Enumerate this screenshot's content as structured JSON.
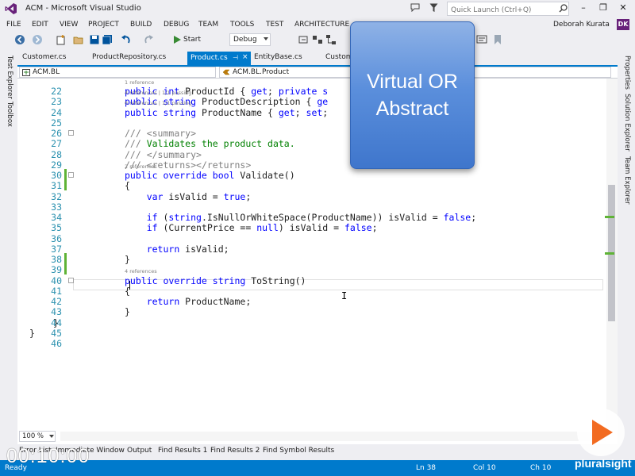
{
  "window": {
    "title": "ACM - Microsoft Visual Studio",
    "quick_launch_placeholder": "Quick Launch (Ctrl+Q)",
    "user_name": "Deborah Kurata",
    "user_initials": "DK",
    "minimize_glyph": "–",
    "restore_glyph": "❐",
    "close_glyph": "✕"
  },
  "menu": [
    "FILE",
    "EDIT",
    "VIEW",
    "PROJECT",
    "BUILD",
    "DEBUG",
    "TEAM",
    "TOOLS",
    "TEST",
    "ARCHITECTURE"
  ],
  "toolbar": {
    "start_label": "Start",
    "configuration": "Debug"
  },
  "side_tabs": {
    "left": [
      "Test Explorer",
      "Toolbox"
    ],
    "right": [
      "Properties",
      "Solution Explorer",
      "Team Explorer"
    ]
  },
  "doc_tabs": {
    "items": [
      "Customer.cs",
      "ProductRepository.cs",
      "Product.cs",
      "EntityBase.cs",
      "Custom"
    ],
    "active": "Product.cs",
    "pin_glyph": "⊣",
    "close_glyph": "×"
  },
  "navbar": {
    "project": "ACM.BL",
    "class": "ACM.BL.Product"
  },
  "code": {
    "lines": [
      {
        "n": "22",
        "refs": "1 reference",
        "segments": [
          {
            "t": "public ",
            "k": "kw"
          },
          {
            "t": "int ",
            "k": "kw"
          },
          {
            "t": "ProductId { ",
            "k": ""
          },
          {
            "t": "get",
            "k": "kw"
          },
          {
            "t": "; ",
            "k": ""
          },
          {
            "t": "private ",
            "k": "kw"
          },
          {
            "t": "s",
            "k": "kw"
          }
        ]
      },
      {
        "n": "23",
        "refs": "4 references | 1/1 passing",
        "segments": [
          {
            "t": "public ",
            "k": "kw"
          },
          {
            "t": "string ",
            "k": "kw"
          },
          {
            "t": "ProductDescription { ",
            "k": ""
          },
          {
            "t": "ge",
            "k": "kw"
          }
        ]
      },
      {
        "n": "24",
        "refs": "6 references | 1/1 passing",
        "segments": [
          {
            "t": "public ",
            "k": "kw"
          },
          {
            "t": "string ",
            "k": "kw"
          },
          {
            "t": "ProductName { ",
            "k": ""
          },
          {
            "t": "get",
            "k": "kw"
          },
          {
            "t": "; ",
            "k": ""
          },
          {
            "t": "set",
            "k": "kw"
          },
          {
            "t": ";",
            "k": ""
          }
        ]
      },
      {
        "n": "25",
        "refs": "",
        "segments": []
      },
      {
        "n": "26",
        "refs": "",
        "segments": [
          {
            "t": "/// ",
            "k": "cmg"
          },
          {
            "t": "<summary>",
            "k": "cmg"
          }
        ]
      },
      {
        "n": "27",
        "refs": "",
        "segments": [
          {
            "t": "/// ",
            "k": "cmg"
          },
          {
            "t": "Validates the product data.",
            "k": "cm"
          }
        ]
      },
      {
        "n": "28",
        "refs": "",
        "segments": [
          {
            "t": "/// ",
            "k": "cmg"
          },
          {
            "t": "</summary>",
            "k": "cmg"
          }
        ]
      },
      {
        "n": "29",
        "refs": "",
        "segments": [
          {
            "t": "/// ",
            "k": "cmg"
          },
          {
            "t": "<returns></returns>",
            "k": "cmg"
          }
        ]
      },
      {
        "n": "30",
        "refs": "2 references",
        "segments": [
          {
            "t": "public ",
            "k": "kw"
          },
          {
            "t": "override ",
            "k": "kw"
          },
          {
            "t": "bool ",
            "k": "kw"
          },
          {
            "t": "Validate()",
            "k": ""
          }
        ]
      },
      {
        "n": "31",
        "refs": "",
        "segments": [
          {
            "t": "{",
            "k": ""
          }
        ]
      },
      {
        "n": "32",
        "refs": "",
        "segments": [
          {
            "t": "    ",
            "k": ""
          },
          {
            "t": "var ",
            "k": "kw"
          },
          {
            "t": "isValid = ",
            "k": ""
          },
          {
            "t": "true",
            "k": "kw"
          },
          {
            "t": ";",
            "k": ""
          }
        ]
      },
      {
        "n": "33",
        "refs": "",
        "segments": []
      },
      {
        "n": "34",
        "refs": "",
        "segments": [
          {
            "t": "    ",
            "k": ""
          },
          {
            "t": "if ",
            "k": "kw"
          },
          {
            "t": "(",
            "k": ""
          },
          {
            "t": "string",
            "k": "kw"
          },
          {
            "t": ".IsNullOrWhiteSpace(ProductName)) isValid = ",
            "k": ""
          },
          {
            "t": "false",
            "k": "kw"
          },
          {
            "t": ";",
            "k": ""
          }
        ]
      },
      {
        "n": "35",
        "refs": "",
        "segments": [
          {
            "t": "    ",
            "k": ""
          },
          {
            "t": "if ",
            "k": "kw"
          },
          {
            "t": "(CurrentPrice == ",
            "k": ""
          },
          {
            "t": "null",
            "k": "kw"
          },
          {
            "t": ") isValid = ",
            "k": ""
          },
          {
            "t": "false",
            "k": "kw"
          },
          {
            "t": ";",
            "k": ""
          }
        ]
      },
      {
        "n": "36",
        "refs": "",
        "segments": []
      },
      {
        "n": "37",
        "refs": "",
        "segments": [
          {
            "t": "    ",
            "k": ""
          },
          {
            "t": "return ",
            "k": "kw"
          },
          {
            "t": "isValid;",
            "k": ""
          }
        ]
      },
      {
        "n": "38",
        "refs": "",
        "segments": [
          {
            "t": "}",
            "k": ""
          }
        ]
      },
      {
        "n": "39",
        "refs": "",
        "segments": []
      },
      {
        "n": "40",
        "refs": "4 references",
        "segments": [
          {
            "t": "public ",
            "k": "kw"
          },
          {
            "t": "override ",
            "k": "kw"
          },
          {
            "t": "string ",
            "k": "kw"
          },
          {
            "t": "ToString()",
            "k": ""
          }
        ]
      },
      {
        "n": "41",
        "refs": "",
        "segments": [
          {
            "t": "{",
            "k": ""
          }
        ]
      },
      {
        "n": "42",
        "refs": "",
        "segments": [
          {
            "t": "    ",
            "k": ""
          },
          {
            "t": "return ",
            "k": "kw"
          },
          {
            "t": "ProductName;",
            "k": ""
          }
        ]
      },
      {
        "n": "43",
        "refs": "",
        "segments": [
          {
            "t": "}",
            "k": ""
          }
        ]
      },
      {
        "n": "44",
        "refs": "",
        "segments": [
          {
            "t": "}",
            "k": ""
          }
        ]
      },
      {
        "n": "45",
        "refs": "",
        "segments": [
          {
            "t": "}",
            "k": ""
          }
        ]
      },
      {
        "n": "46",
        "refs": "",
        "segments": []
      }
    ]
  },
  "overlay": {
    "line1": "Virtual OR",
    "line2": "Abstract"
  },
  "zoom": "100 %",
  "bottom_tabs": [
    "Error List",
    "Immediate Window",
    "Output",
    "Find Results 1",
    "Find Results 2",
    "Find Symbol Results"
  ],
  "status": {
    "state": "Ready",
    "line": "Ln 38",
    "col": "Col 10",
    "ch": "Ch 10"
  },
  "video": {
    "timestamp": "00:10:00",
    "brand": "pluralsight"
  },
  "colors": {
    "accent": "#007acc",
    "keyword": "#0000ff",
    "comment": "#008000",
    "line_number": "#2b91af",
    "vs_purple": "#68217a"
  }
}
